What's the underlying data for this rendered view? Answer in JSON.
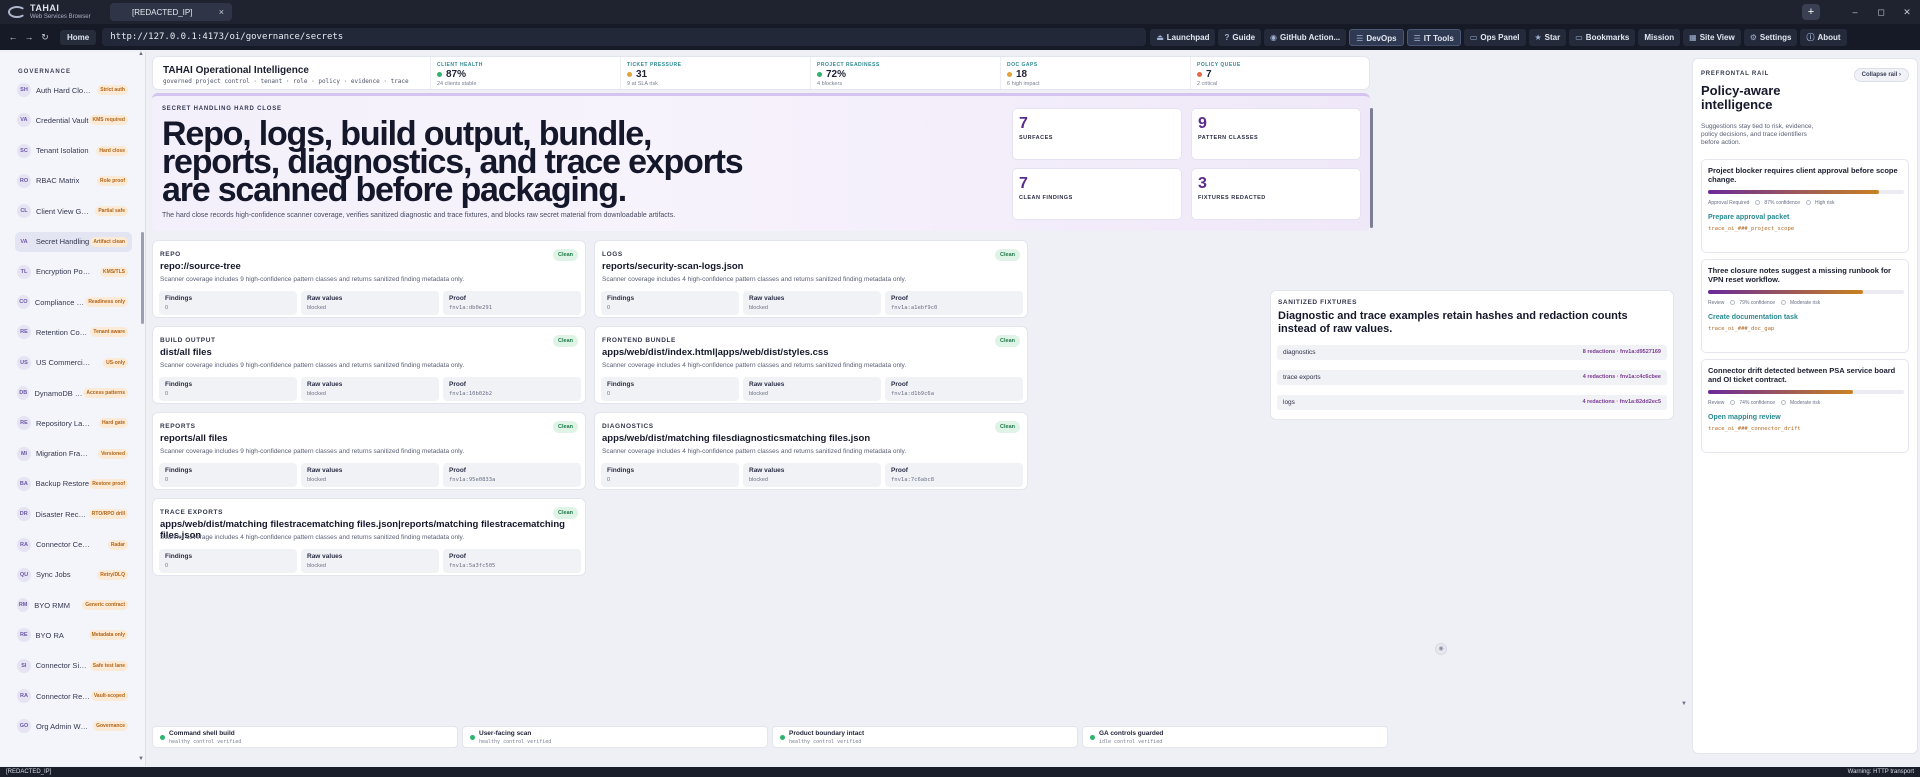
{
  "titlebar": {
    "brand_name": "TAHAI",
    "brand_sub": "Web Services Browser",
    "tab_label": "[REDACTED_IP]",
    "tab_close": "×",
    "new_tab": "+",
    "minimize": "–",
    "maximize": "◻",
    "close": "✕"
  },
  "navbar": {
    "back": "←",
    "forward": "→",
    "reload": "↻",
    "home": "Home",
    "url": "http://127.0.0.1:4173/oi/governance/secrets",
    "tools": [
      {
        "label": "Launchpad",
        "icon": "⏏"
      },
      {
        "label": "Guide",
        "icon": "?"
      },
      {
        "label": "GitHub Action...",
        "icon": "◉"
      },
      {
        "label": "DevOps",
        "icon": "☰"
      },
      {
        "label": "IT Tools",
        "icon": "☰"
      },
      {
        "label": "Ops Panel",
        "icon": "▭"
      },
      {
        "label": "Star",
        "icon": "★"
      },
      {
        "label": "Bookmarks",
        "icon": "▭"
      },
      {
        "label": "Mission",
        "icon": ""
      },
      {
        "label": "Site View",
        "icon": "▦"
      },
      {
        "label": "Settings",
        "icon": "⚙"
      },
      {
        "label": "About",
        "icon": "ⓘ"
      }
    ]
  },
  "sidebar": {
    "heading": "GOVERNANCE",
    "items": [
      {
        "abbr": "SH",
        "label": "Auth Hard Close",
        "badge": "Strict auth"
      },
      {
        "abbr": "VA",
        "label": "Credential Vault",
        "badge": "KMS required"
      },
      {
        "abbr": "SC",
        "label": "Tenant Isolation",
        "badge": "Hard close"
      },
      {
        "abbr": "RO",
        "label": "RBAC Matrix",
        "badge": "Role proof"
      },
      {
        "abbr": "CL",
        "label": "Client View Guard",
        "badge": "Partial safe"
      },
      {
        "abbr": "VA",
        "label": "Secret Handling",
        "badge": "Artifact clean"
      },
      {
        "abbr": "TL",
        "label": "Encryption Posture",
        "badge": "KMS/TLS"
      },
      {
        "abbr": "CO",
        "label": "Compliance Ma...",
        "badge": "Readiness only"
      },
      {
        "abbr": "RE",
        "label": "Retention Contr...",
        "badge": "Tenant aware"
      },
      {
        "abbr": "US",
        "label": "US Commercial Gate",
        "badge": "US-only"
      },
      {
        "abbr": "DB",
        "label": "DynamoDB De...",
        "badge": "Access patterns"
      },
      {
        "abbr": "RE",
        "label": "Repository Layer",
        "badge": "Hard gate"
      },
      {
        "abbr": "MI",
        "label": "Migration Framewo...",
        "badge": "Versioned"
      },
      {
        "abbr": "BA",
        "label": "Backup Restore",
        "badge": "Restore proof"
      },
      {
        "abbr": "DR",
        "label": "Disaster Recovery",
        "badge": "RTO/RPO drill"
      },
      {
        "abbr": "RA",
        "label": "Connector Center",
        "badge": "Radar"
      },
      {
        "abbr": "QU",
        "label": "Sync Jobs",
        "badge": "Retry/DLQ"
      },
      {
        "abbr": "RM",
        "label": "BYO RMM",
        "badge": "Generic contract"
      },
      {
        "abbr": "RE",
        "label": "BYO RA",
        "badge": "Metadata only"
      },
      {
        "abbr": "SI",
        "label": "Connector Simul...",
        "badge": "Safe test lane"
      },
      {
        "abbr": "RA",
        "label": "Connector Regist...",
        "badge": "Vault-scoped"
      },
      {
        "abbr": "GO",
        "label": "Org Admin Workfl...",
        "badge": "Governance"
      }
    ]
  },
  "header": {
    "title": "TAHAI Operational Intelligence",
    "subtitle": "governed project control · tenant · role · policy · evidence · trace",
    "kpis": [
      {
        "label": "CLIENT HEALTH",
        "value": "87%",
        "sub": "24 clients stable",
        "color": "#2fb36d"
      },
      {
        "label": "TICKET PRESSURE",
        "value": "31",
        "sub": "9 at SLA risk",
        "color": "#e2a23a"
      },
      {
        "label": "PROJECT READINESS",
        "value": "72%",
        "sub": "4 blockers",
        "color": "#2fb36d"
      },
      {
        "label": "DOC GAPS",
        "value": "18",
        "sub": "6 high impact",
        "color": "#e2a23a"
      },
      {
        "label": "POLICY QUEUE",
        "value": "7",
        "sub": "2 critical",
        "color": "#e06a4a"
      }
    ]
  },
  "hero": {
    "eyebrow": "SECRET HANDLING HARD CLOSE",
    "title": "Repo, logs, build output, bundle, reports, diagnostics, and trace exports are scanned before packaging.",
    "description": "The hard close records high-confidence scanner coverage, verifies sanitized diagnostic and trace fixtures, and blocks raw secret material from downloadable artifacts.",
    "stats": [
      {
        "value": "7",
        "label": "SURFACES"
      },
      {
        "value": "9",
        "label": "PATTERN CLASSES"
      },
      {
        "value": "7",
        "label": "CLEAN FINDINGS"
      },
      {
        "value": "3",
        "label": "FIXTURES REDACTED"
      }
    ]
  },
  "surfaces": [
    {
      "eyebrow": "REPO",
      "title": "repo://source-tree",
      "desc": "Scanner coverage includes 9 high-confidence pattern classes and returns sanitized finding metadata only.",
      "status": "Clean",
      "findings": "0",
      "raw": "blocked",
      "proof": "fnv1a:db0e291"
    },
    {
      "eyebrow": "LOGS",
      "title": "reports/security-scan-logs.json",
      "desc": "Scanner coverage includes 4 high-confidence pattern classes and returns sanitized finding metadata only.",
      "status": "Clean",
      "findings": "0",
      "raw": "blocked",
      "proof": "fnv1a:a1ebf9c0"
    },
    {
      "eyebrow": "BUILD OUTPUT",
      "title": "dist/all files",
      "desc": "Scanner coverage includes 9 high-confidence pattern classes and returns sanitized finding metadata only.",
      "status": "Clean",
      "findings": "0",
      "raw": "blocked",
      "proof": "fnv1a:10b02b2"
    },
    {
      "eyebrow": "FRONTEND BUNDLE",
      "title": "apps/web/dist/index.html|apps/web/dist/styles.css",
      "desc": "Scanner coverage includes 4 high-confidence pattern classes and returns sanitized finding metadata only.",
      "status": "Clean",
      "findings": "0",
      "raw": "blocked",
      "proof": "fnv1a:d1b9c6a"
    },
    {
      "eyebrow": "REPORTS",
      "title": "reports/all files",
      "desc": "Scanner coverage includes 9 high-confidence pattern classes and returns sanitized finding metadata only.",
      "status": "Clean",
      "findings": "0",
      "raw": "blocked",
      "proof": "fnv1a:95e0833a"
    },
    {
      "eyebrow": "DIAGNOSTICS",
      "title": "apps/web/dist/matching filesdiagnosticsmatching files.json",
      "desc": "Scanner coverage includes 4 high-confidence pattern classes and returns sanitized finding metadata only.",
      "status": "Clean",
      "findings": "0",
      "raw": "blocked",
      "proof": "fnv1a:7c6abc8"
    },
    {
      "eyebrow": "TRACE EXPORTS",
      "title": "apps/web/dist/matching filestracematching files.json|reports/matching filestracematching files.json",
      "desc": "Scanner coverage includes 4 high-confidence pattern classes and returns sanitized finding metadata only.",
      "status": "Clean",
      "findings": "0",
      "raw": "blocked",
      "proof": "fnv1a:5a3fc505"
    }
  ],
  "labels": {
    "findings": "Findings",
    "raw": "Raw values",
    "proof": "Proof"
  },
  "fixtures": {
    "eyebrow": "SANITIZED FIXTURES",
    "title": "Diagnostic and trace examples retain hashes and redaction counts instead of raw values.",
    "rows": [
      {
        "name": "diagnostics",
        "value": "8 redactions · fnv1a:d9527169"
      },
      {
        "name": "trace exports",
        "value": "4 redactions · fnv1a:c4c6cbee"
      },
      {
        "name": "logs",
        "value": "4 redactions · fnv1a:82dd2ec5"
      }
    ]
  },
  "footer_checks": [
    {
      "title": "Command shell build",
      "sub": "healthy control verified"
    },
    {
      "title": "User-facing scan",
      "sub": "healthy control verified"
    },
    {
      "title": "Product boundary intact",
      "sub": "healthy control verified"
    },
    {
      "title": "GA controls guarded",
      "sub": "idle control verified"
    }
  ],
  "rail": {
    "eyebrow": "PREFRONTAL RAIL",
    "title": "Policy-aware intelligence",
    "desc": "Suggestions stay tied to risk, evidence, policy decisions, and trace identifiers before action.",
    "collapse": "Collapse rail",
    "suggestions": [
      {
        "title": "Project blocker requires client approval before scope change.",
        "progress": 0.87,
        "status": "Approval Required",
        "confidence": "87% confidence",
        "risk": "High risk",
        "action": "Prepare approval packet",
        "trace": "trace_oi_###_project_scope"
      },
      {
        "title": "Three closure notes suggest a missing runbook for VPN reset workflow.",
        "progress": 0.79,
        "status": "Review",
        "confidence": "79% confidence",
        "risk": "Moderate risk",
        "action": "Create documentation task",
        "trace": "trace_oi_###_doc_gap"
      },
      {
        "title": "Connector drift detected between PSA service board and OI ticket contract.",
        "progress": 0.74,
        "status": "Review",
        "confidence": "74% confidence",
        "risk": "Moderate risk",
        "action": "Open mapping review",
        "trace": "trace_oi_###_connector_drift"
      }
    ]
  },
  "statusbar": {
    "left": "[REDACTED_IP]",
    "right": "Warning: HTTP transport"
  }
}
